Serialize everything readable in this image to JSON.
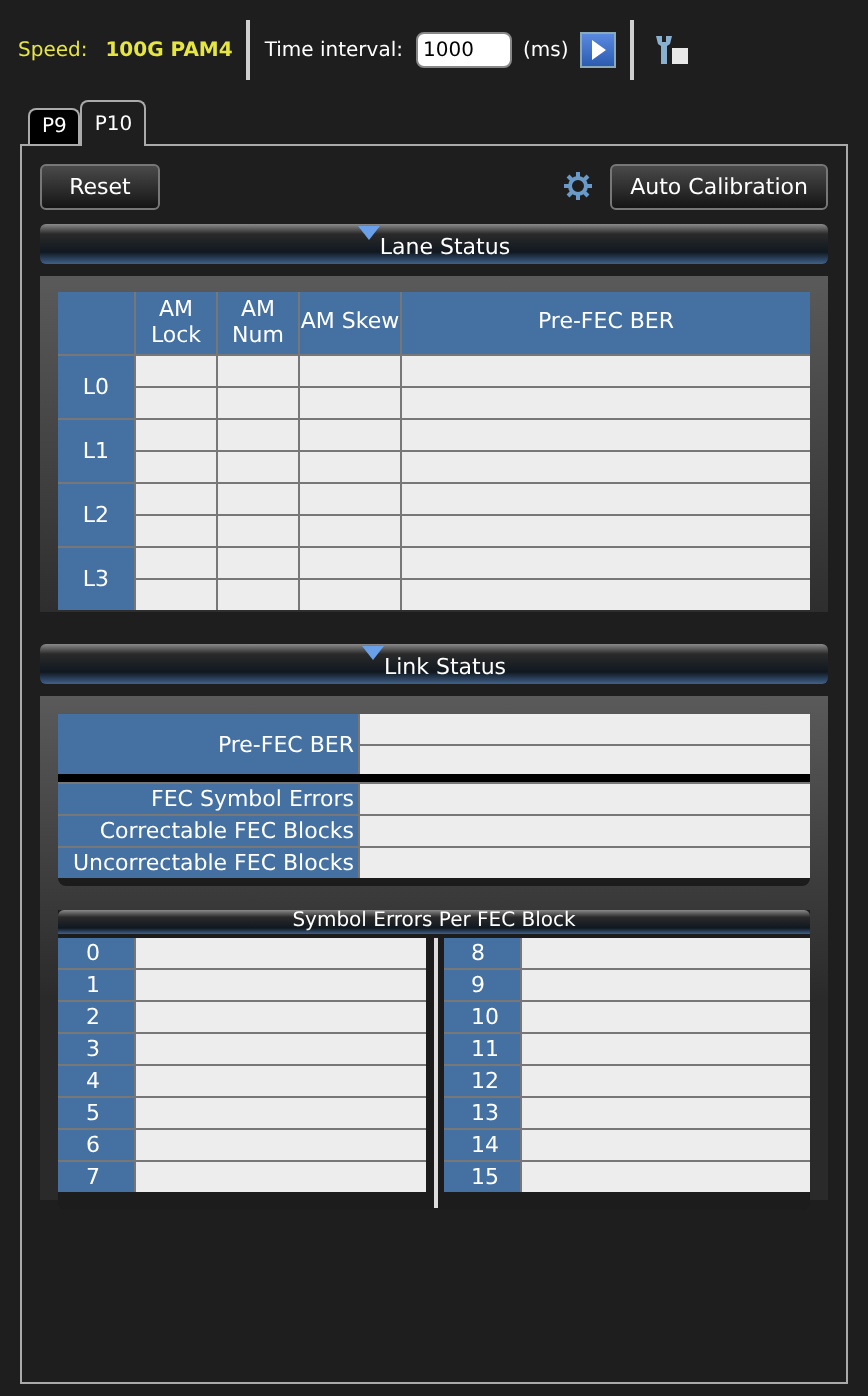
{
  "toolbar": {
    "speed_label": "Speed:",
    "speed_value": "100G PAM4",
    "interval_label": "Time interval:",
    "interval_value": "1000",
    "interval_unit": "(ms)"
  },
  "tabs": [
    {
      "label": "P9",
      "selected": false
    },
    {
      "label": "P10",
      "selected": true
    }
  ],
  "buttons": {
    "reset": "Reset",
    "auto_calibration": "Auto Calibration"
  },
  "lane_status": {
    "title": "Lane Status",
    "expanded": true,
    "columns": [
      "AM Lock",
      "AM Num",
      "AM Skew",
      "Pre-FEC BER"
    ],
    "lanes": [
      "L0",
      "L1",
      "L2",
      "L3"
    ]
  },
  "link_status": {
    "title": "Link Status",
    "expanded": true,
    "ber_label": "Pre-FEC BER",
    "counters": [
      "FEC Symbol Errors",
      "Correctable FEC Blocks",
      "Uncorrectable FEC Blocks"
    ]
  },
  "symbol_errors": {
    "title": "Symbol Errors Per FEC Block",
    "blocks": [
      "0",
      "1",
      "2",
      "3",
      "4",
      "5",
      "6",
      "7",
      "8",
      "9",
      "10",
      "11",
      "12",
      "13",
      "14",
      "15"
    ]
  }
}
